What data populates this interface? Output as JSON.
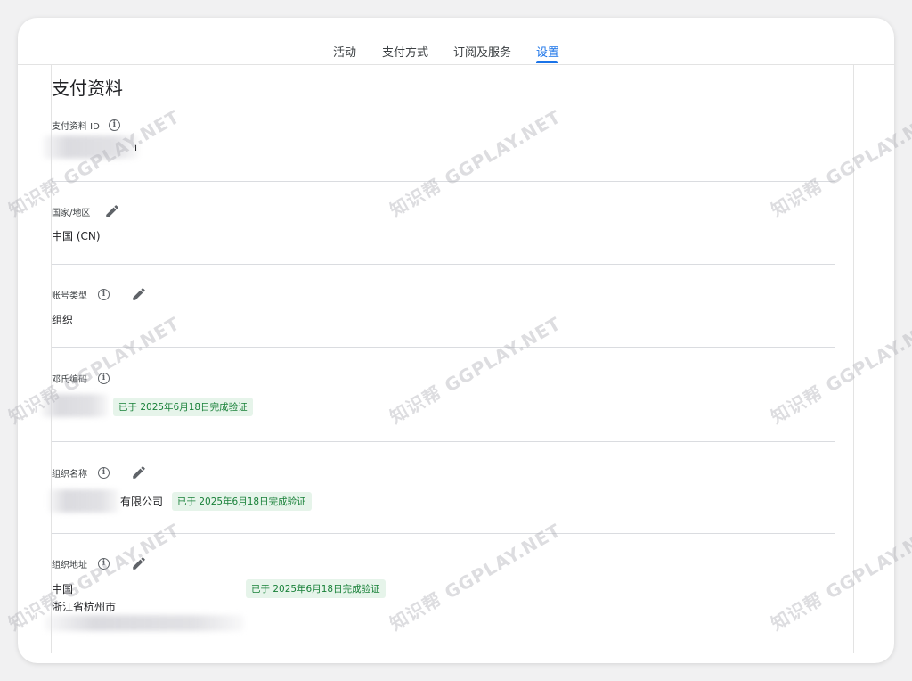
{
  "tabs": [
    {
      "label": "活动",
      "active": false
    },
    {
      "label": "支付方式",
      "active": false
    },
    {
      "label": "订阅及服务",
      "active": false
    },
    {
      "label": "设置",
      "active": true
    }
  ],
  "page_title": "支付资料",
  "fields": {
    "profile_id": {
      "label": "支付资料 ID",
      "value_suffix": "i"
    },
    "country": {
      "label": "国家/地区",
      "value": "中国 (CN)"
    },
    "account_type": {
      "label": "账号类型",
      "value": "组织"
    },
    "duns": {
      "label": "邓氏编码",
      "badge": "已于 2025年6月18日完成验证"
    },
    "org_name": {
      "label": "组织名称",
      "value_suffix": "有限公司",
      "badge": "已于 2025年6月18日完成验证"
    },
    "org_address": {
      "label": "组织地址",
      "line1": "中国",
      "line2": "浙江省杭州市",
      "badge": "已于 2025年6月18日完成验证"
    }
  },
  "watermark": {
    "text": "知识帮 GGPLAY.NET"
  },
  "colors": {
    "accent": "#1a73e8",
    "verified_bg": "#e6f4ea",
    "verified_text": "#188038"
  },
  "icons": {
    "info": "info-icon",
    "edit": "pencil-icon"
  }
}
